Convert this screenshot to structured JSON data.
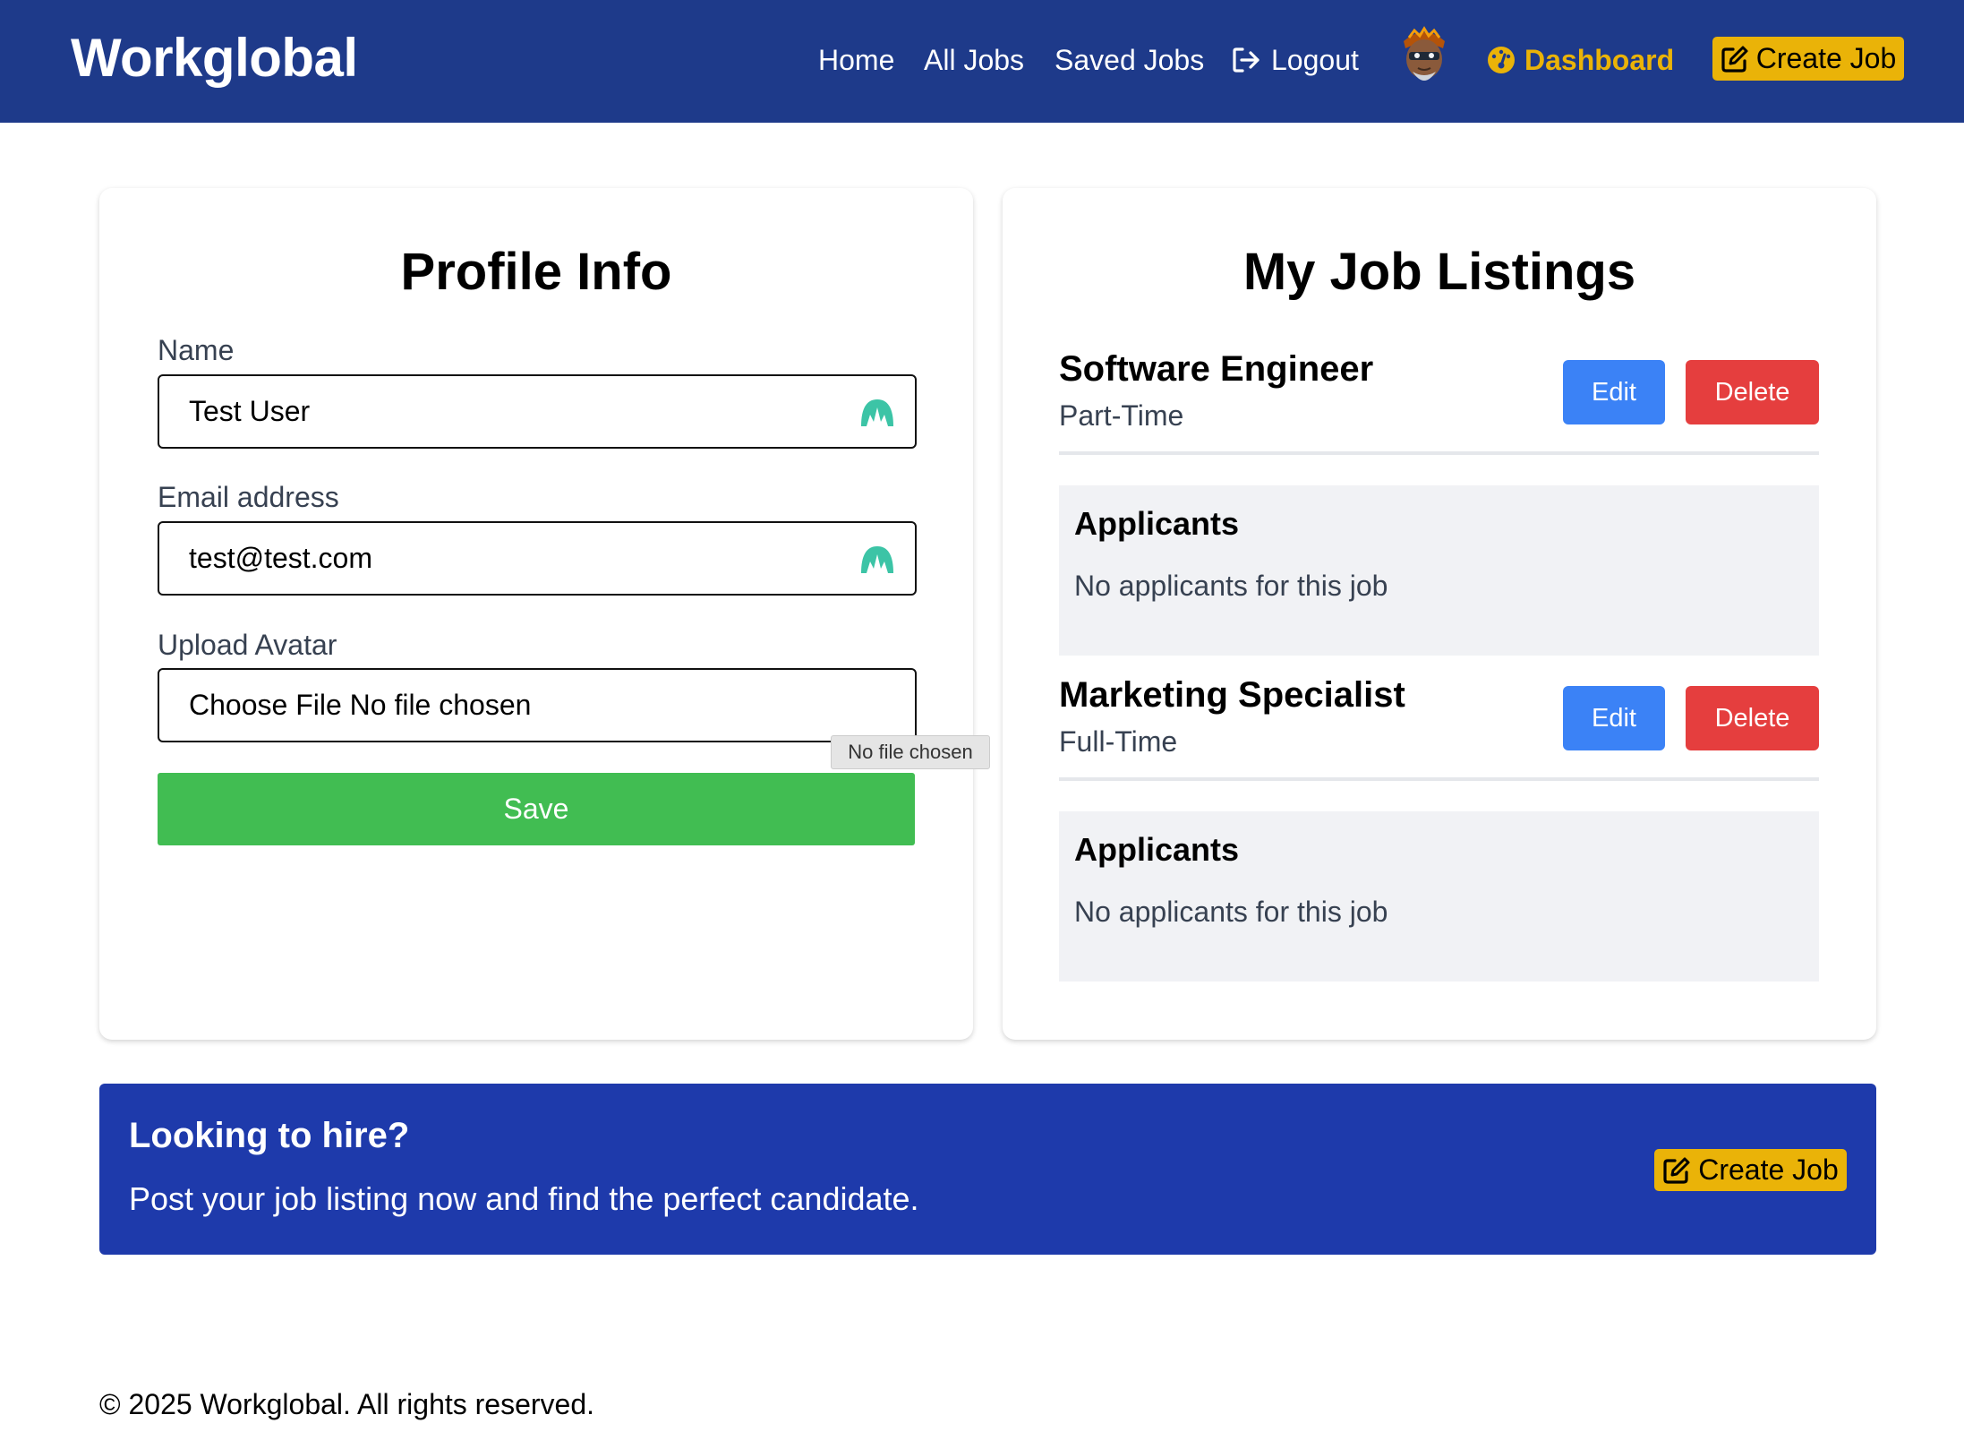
{
  "header": {
    "brand": "Workglobal",
    "nav": {
      "home": "Home",
      "all_jobs": "All Jobs",
      "saved_jobs": "Saved Jobs",
      "logout": "Logout",
      "dashboard": "Dashboard",
      "create_job": "Create Job"
    }
  },
  "profile": {
    "title": "Profile Info",
    "name_label": "Name",
    "name_value": "Test User",
    "email_label": "Email address",
    "email_value": "test@test.com",
    "avatar_label": "Upload Avatar",
    "file_input_text": "Choose File No file chosen",
    "tooltip": "No file chosen",
    "save_label": "Save"
  },
  "listings": {
    "title": "My Job Listings",
    "edit_label": "Edit",
    "delete_label": "Delete",
    "applicants_title": "Applicants",
    "no_applicants": "No applicants for this job",
    "jobs": [
      {
        "title": "Software Engineer",
        "type": "Part-Time"
      },
      {
        "title": "Marketing Specialist",
        "type": "Full-Time"
      }
    ]
  },
  "cta": {
    "title": "Looking to hire?",
    "text": "Post your job listing now and find the perfect candidate.",
    "button": "Create Job"
  },
  "footer": {
    "text": "© 2025 Workglobal. All rights reserved."
  },
  "colors": {
    "header_bg": "#1e3a8a",
    "accent_yellow": "#eab308",
    "save_green": "#41bd52",
    "edit_blue": "#3b82f6",
    "delete_red": "#e53e3e",
    "cta_bg": "#1e3aab"
  },
  "icons": {
    "logout": "sign-out-icon",
    "dashboard": "gauge-icon",
    "create_job": "edit-icon",
    "field_autofill": "password-manager-icon"
  }
}
